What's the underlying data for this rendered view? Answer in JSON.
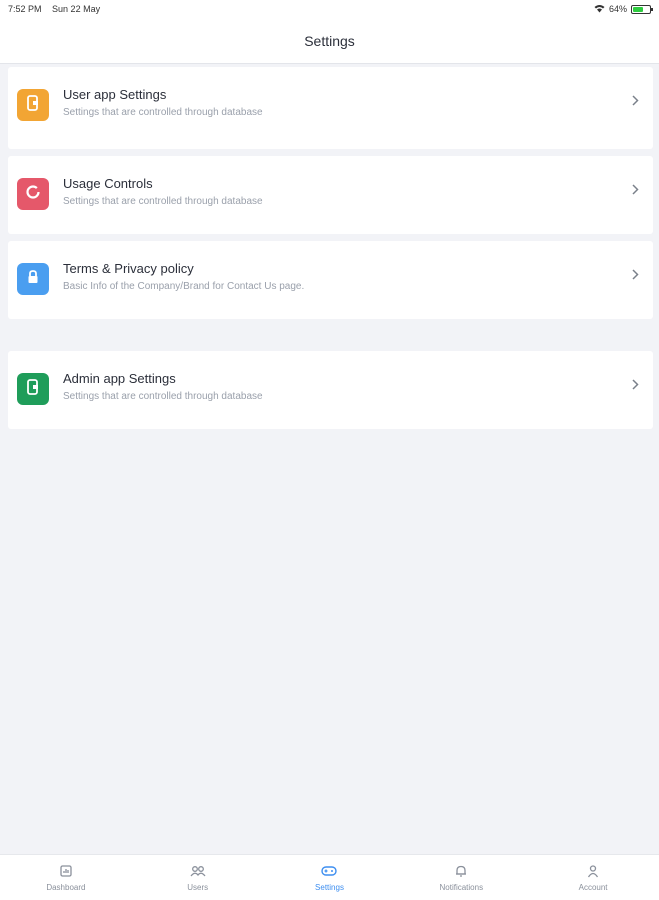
{
  "status_bar": {
    "time": "7:52 PM",
    "date": "Sun 22 May",
    "battery": "64%",
    "battery_level": 0.64
  },
  "header": {
    "title": "Settings"
  },
  "cards": [
    {
      "title": "User app Settings",
      "subtitle": "Settings that are controlled through database",
      "icon": "phone-icon",
      "color": "#f2a534"
    },
    {
      "title": "Usage Controls",
      "subtitle": "Settings that are controlled through database",
      "icon": "ring-icon",
      "color": "#e5586a"
    },
    {
      "title": "Terms & Privacy policy",
      "subtitle": "Basic Info of the Company/Brand for Contact Us page.",
      "icon": "lock-icon",
      "color": "#4a9ef0"
    },
    {
      "title": "Admin app Settings",
      "subtitle": "Settings that are controlled through database",
      "icon": "phone-icon",
      "color": "#1f9d5a"
    }
  ],
  "tabs": [
    {
      "label": "Dashboard",
      "icon": "dashboard-icon"
    },
    {
      "label": "Users",
      "icon": "users-icon"
    },
    {
      "label": "Settings",
      "icon": "gamepad-icon",
      "active": true
    },
    {
      "label": "Notifications",
      "icon": "bell-icon"
    },
    {
      "label": "Account",
      "icon": "person-icon"
    }
  ],
  "colors": {
    "accent": "#3d8ef0",
    "background": "#f2f3f7"
  }
}
